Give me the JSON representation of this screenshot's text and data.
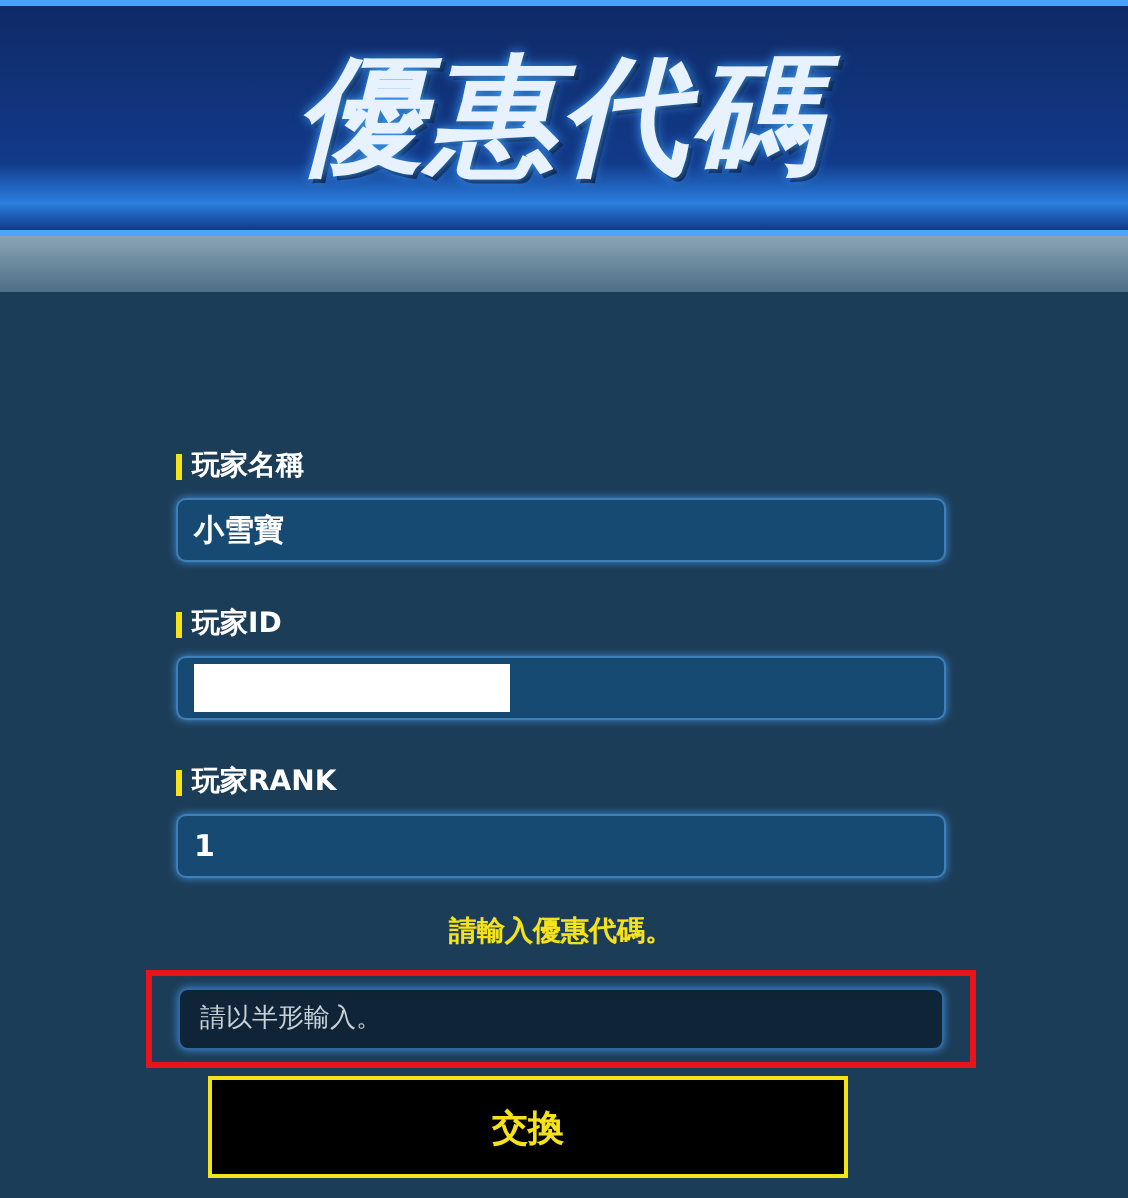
{
  "header": {
    "title": "優惠代碼"
  },
  "fields": [
    {
      "label": "玩家名稱",
      "value": "小雪寶",
      "redacted": false
    },
    {
      "label": "玩家ID",
      "redacted": true
    },
    {
      "label": "玩家RANK",
      "value": "1",
      "redacted": false
    }
  ],
  "prompt": "請輸入優惠代碼。",
  "code_field": {
    "placeholder": "請以半形輸入。",
    "highlighted": true
  },
  "button": {
    "label": "交換"
  }
}
